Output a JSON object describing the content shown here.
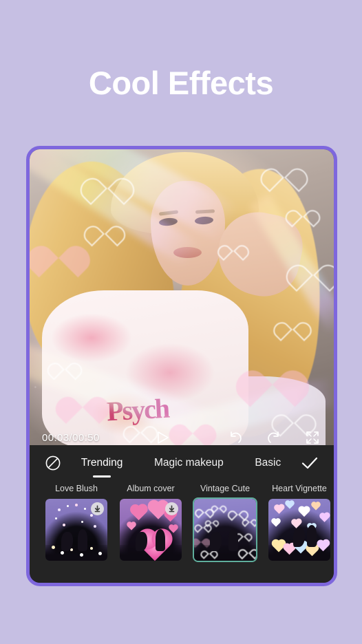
{
  "headline": "Cool Effects",
  "theme": {
    "background": "#c6bfe3",
    "frame_border": "#7e67dd",
    "panel_background": "#242424",
    "selected_thumb_border": "#5fae9c",
    "text_primary": "#ffffff"
  },
  "preview": {
    "shirt_text": "Psych",
    "controls": {
      "timecode": "00:03/00:50",
      "play_label": "play-button",
      "undo_label": "undo-button",
      "redo_label": "redo-button",
      "fullscreen_label": "fullscreen-button"
    }
  },
  "panel": {
    "no_effect_label": "no-effect",
    "confirm_label": "confirm",
    "tabs": [
      {
        "label": "Trending",
        "active": true
      },
      {
        "label": "Magic makeup",
        "active": false
      },
      {
        "label": "Basic",
        "active": false
      }
    ],
    "effects": [
      {
        "name": "Love Blush",
        "selected": false,
        "downloadable": true
      },
      {
        "name": "Album cover",
        "selected": false,
        "downloadable": true
      },
      {
        "name": "Vintage Cute",
        "selected": true,
        "downloadable": false
      },
      {
        "name": "Heart Vignette",
        "selected": false,
        "downloadable": false
      }
    ]
  }
}
